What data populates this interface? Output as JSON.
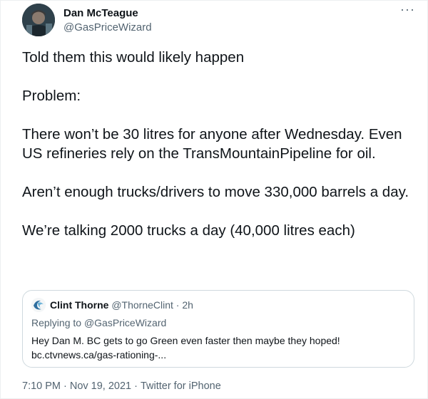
{
  "tweet": {
    "author_name": "Dan McTeague",
    "author_handle": "@GasPriceWizard",
    "more_icon": "more-horizontal-icon",
    "paragraphs": [
      "Told them this would likely happen",
      "Problem:",
      "There won’t be 30 litres for anyone after Wednesday. Even US refineries rely on the TransMountainPipeline for oil.",
      "Aren’t enough trucks/drivers to move 330,000 barrels a day.",
      "We’re talking 2000 trucks a day (40,000 litres each)"
    ]
  },
  "quote": {
    "author_name": "Clint Thorne",
    "author_handle": "@ThorneClint",
    "separator": "·",
    "time_ago": "2h",
    "replying_prefix": "Replying to",
    "replying_to": "@GasPriceWizard",
    "body_line1": "Hey Dan M. BC gets to go Green even faster then maybe they hoped!",
    "body_line2": "bc.ctvnews.ca/gas-rationing-..."
  },
  "footer": {
    "time": "7:10 PM",
    "date": "Nov 19, 2021",
    "source": "Twitter for iPhone",
    "separator": "·"
  },
  "colors": {
    "text": "#0f1419",
    "secondary": "#536471",
    "border": "#cfd9de"
  }
}
